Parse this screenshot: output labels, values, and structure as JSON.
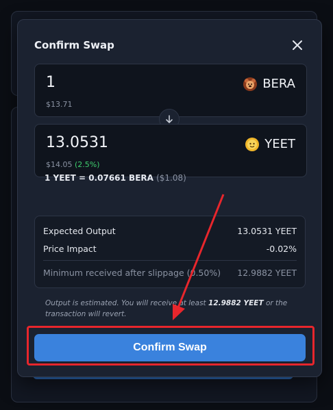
{
  "modal": {
    "title": "Confirm Swap"
  },
  "from": {
    "amount": "1",
    "usd": "$13.71",
    "token": "BERA",
    "token_icon": "bear-token-icon"
  },
  "to": {
    "amount": "13.0531",
    "usd": "$14.05",
    "change": "(2.5%)",
    "token": "YEET",
    "token_icon": "yeet-token-icon"
  },
  "rate": {
    "text": "1 YEET = 0.07661 BERA",
    "usd": "($1.08)"
  },
  "details": {
    "expected_label": "Expected Output",
    "expected_value": "13.0531 YEET",
    "impact_label": "Price Impact",
    "impact_value": "-0.02%",
    "min_label": "Minimum received after slippage (0.50%)",
    "min_value": "12.9882 YEET"
  },
  "note": {
    "pre": "Output is estimated. You will receive at least",
    "amount": "12.9882 YEET",
    "post": "or the transaction will revert."
  },
  "confirm_button": "Confirm Swap",
  "colors": {
    "accent": "#3a82dd",
    "highlight": "#e8262c",
    "positive": "#3fcf6e"
  }
}
